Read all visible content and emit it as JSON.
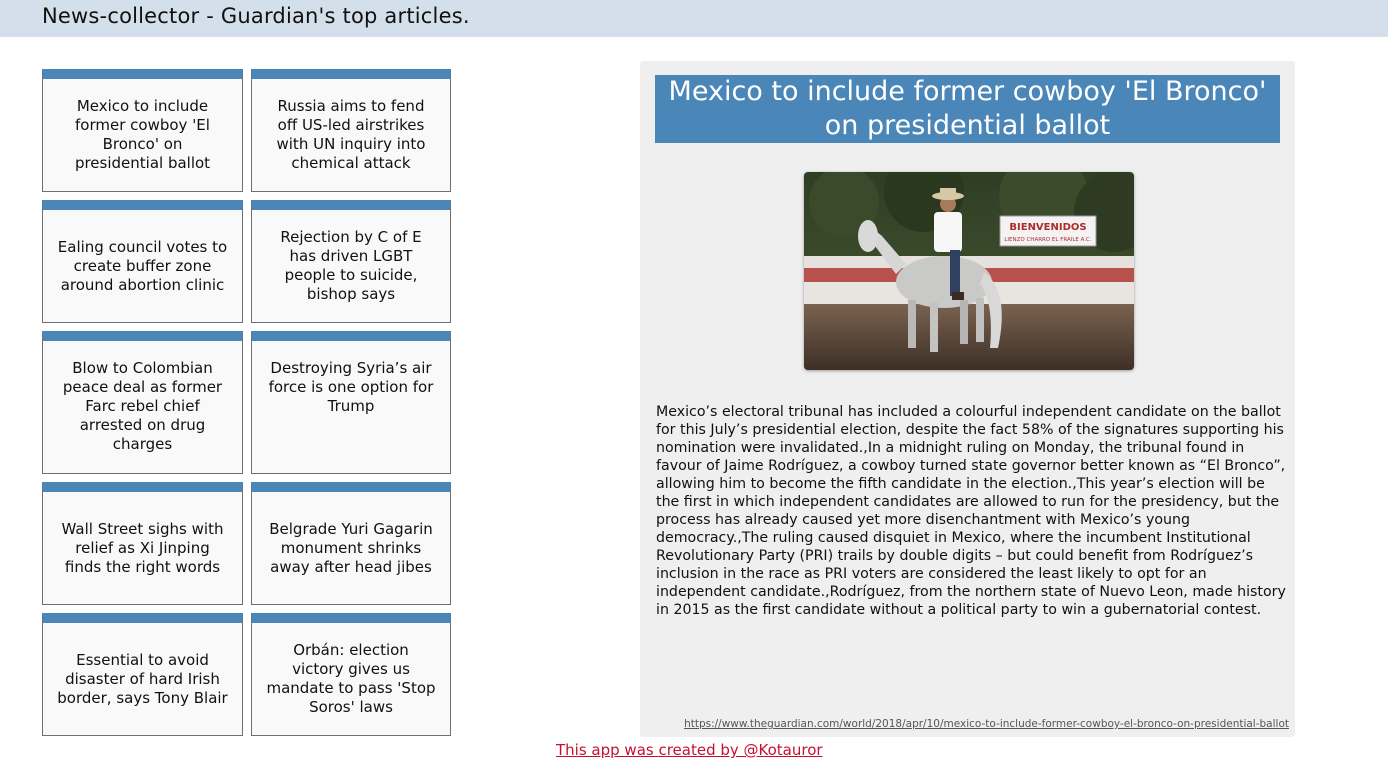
{
  "header": {
    "title": "News-collector - Guardian's top articles."
  },
  "articles": [
    "Mexico to include former cowboy 'El Bronco' on presidential ballot",
    "Russia aims to fend off US-led airstrikes with UN inquiry into chemical attack",
    "Ealing council votes to create buffer zone around abortion clinic",
    "Rejection by C of E has driven LGBT people to suicide, bishop says",
    "Blow to Colombian peace deal as former Farc rebel chief arrested on drug charges",
    "Destroying Syria’s air force is one option for Trump",
    "Wall Street sighs with relief as Xi Jinping finds the right words",
    "Belgrade Yuri Gagarin monument shrinks away after head jibes",
    "Essential to avoid disaster of hard Irish border, says Tony Blair",
    "Orbán: election victory gives us mandate to pass 'Stop Soros' laws"
  ],
  "detail": {
    "title": "Mexico to include former cowboy 'El Bronco' on presidential ballot",
    "sign_line1": "BIENVENIDOS",
    "sign_line2": "LIENZO CHARRO EL FRAILE A.C.",
    "body": "Mexico’s electoral tribunal has included a colourful independent candidate on the ballot for this July’s presidential election, despite the fact 58% of the signatures supporting his nomination were invalidated.,In a midnight ruling on Monday, the tribunal found in favour of Jaime Rodríguez, a cowboy turned state governor better known as “El Bronco”, allowing him to become the fifth candidate in the election.,This year’s election will be the first in which independent candidates are allowed to run for the presidency, but the process has already caused yet more disenchantment with Mexico’s young democracy.,The ruling caused disquiet in Mexico, where the incumbent Institutional Revolutionary Party (PRI) trails by double digits – but could benefit from Rodríguez’s inclusion in the race as PRI voters are considered the least likely to opt for an independent candidate.,Rodríguez, from the northern state of Nuevo Leon, made history in 2015 as the first candidate without a political party to win a gubernatorial contest.",
    "source_url": "https://www.theguardian.com/world/2018/apr/10/mexico-to-include-former-cowboy-el-bronco-on-presidential-ballot"
  },
  "footer": {
    "credit": "This app was created by @Kotauror"
  },
  "colors": {
    "accent": "#4a86b8",
    "header_bg": "#d3dfea",
    "link": "#c8102e",
    "panel_bg": "#efefef"
  }
}
